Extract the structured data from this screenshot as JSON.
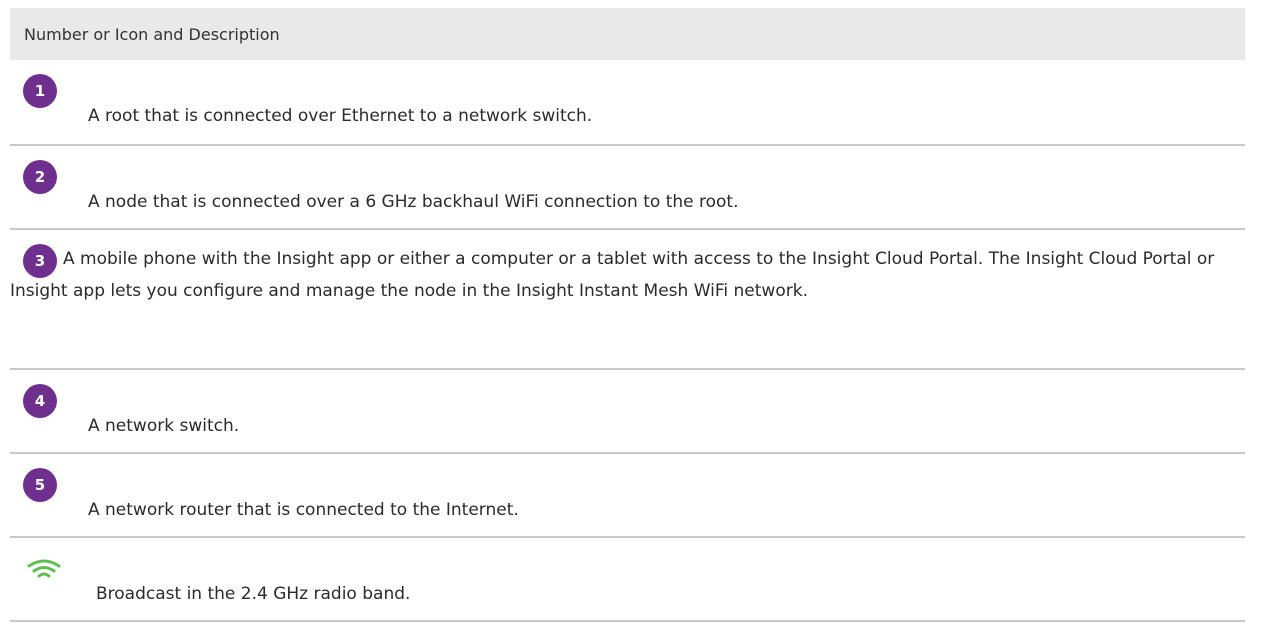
{
  "table": {
    "header": "Number or Icon and Description",
    "rows": [
      {
        "number": "1",
        "description": "A root that is connected over Ethernet to a network switch."
      },
      {
        "number": "2",
        "description": "A node that is connected over a 6 GHz backhaul WiFi connection to the root."
      },
      {
        "number": "3",
        "description": "A mobile phone with the Insight app or either a computer or a tablet with access to the Insight Cloud Portal. The Insight Cloud Portal or Insight app lets you configure and manage the node in the Insight Instant Mesh WiFi network."
      },
      {
        "number": "4",
        "description": "A network switch."
      },
      {
        "number": "5",
        "description": "A network router that is connected to the Internet."
      },
      {
        "icon": "wifi-icon",
        "description": "Broadcast in the 2.4 GHz radio band."
      }
    ]
  },
  "colors": {
    "badge": "#6e2f8f",
    "wifi_icon": "#5fbf4e",
    "header_bg": "#e9e9e9",
    "divider": "#c9c9c9"
  }
}
